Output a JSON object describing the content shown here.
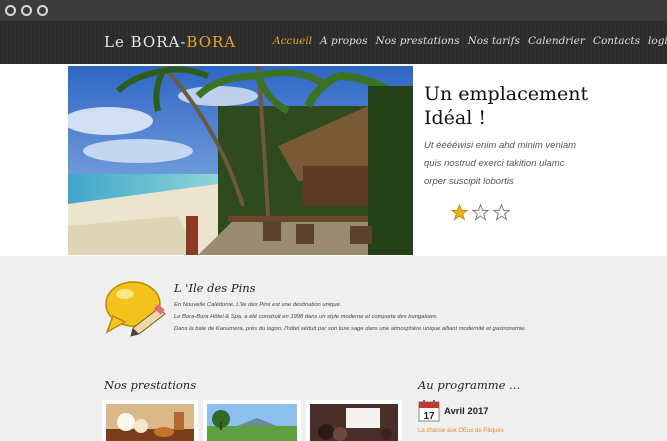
{
  "header": {
    "logo_part1": "Le BORA-",
    "logo_part2": "BORA",
    "nav": [
      "Accueil",
      "A propos",
      "Nos prestations",
      "Nos tarifs",
      "Calendrier",
      "Contacts",
      "login"
    ]
  },
  "hero": {
    "title_line1": "Un emplacement",
    "title_line2": "Idéal !",
    "text_line1": "Ut ééééwisi enim ahd minim veniam",
    "text_line2": "quis nostrud exerci takition ulamc",
    "text_line3": "orper suscipit lobortis",
    "rating": 1,
    "rating_max": 3
  },
  "info": {
    "title": "L 'Ile des Pins",
    "lines": [
      "En Nouvelle Calédonie, L'Ile des Pins est une destination unique.",
      "Le Bora-Bora Hôtel & Spa, a été construit en 1998 dans un style moderne et comporte des bungalows.",
      "Dans la baie de Kanumera, près du lagon, l'hôtel séduit par son luxe sage dans une atmosphère unique alliant modernité et gastronomie."
    ]
  },
  "prestations": {
    "title": "Nos prestations"
  },
  "programme": {
    "title": "Au programme ...",
    "day": "17",
    "month": "Avril 2017",
    "event": "La chasse aux OEux de Pâques"
  },
  "colors": {
    "accent": "#e6a52f",
    "header_bg": "#2e2e2e",
    "chrome_bg": "#3b3b3b"
  }
}
